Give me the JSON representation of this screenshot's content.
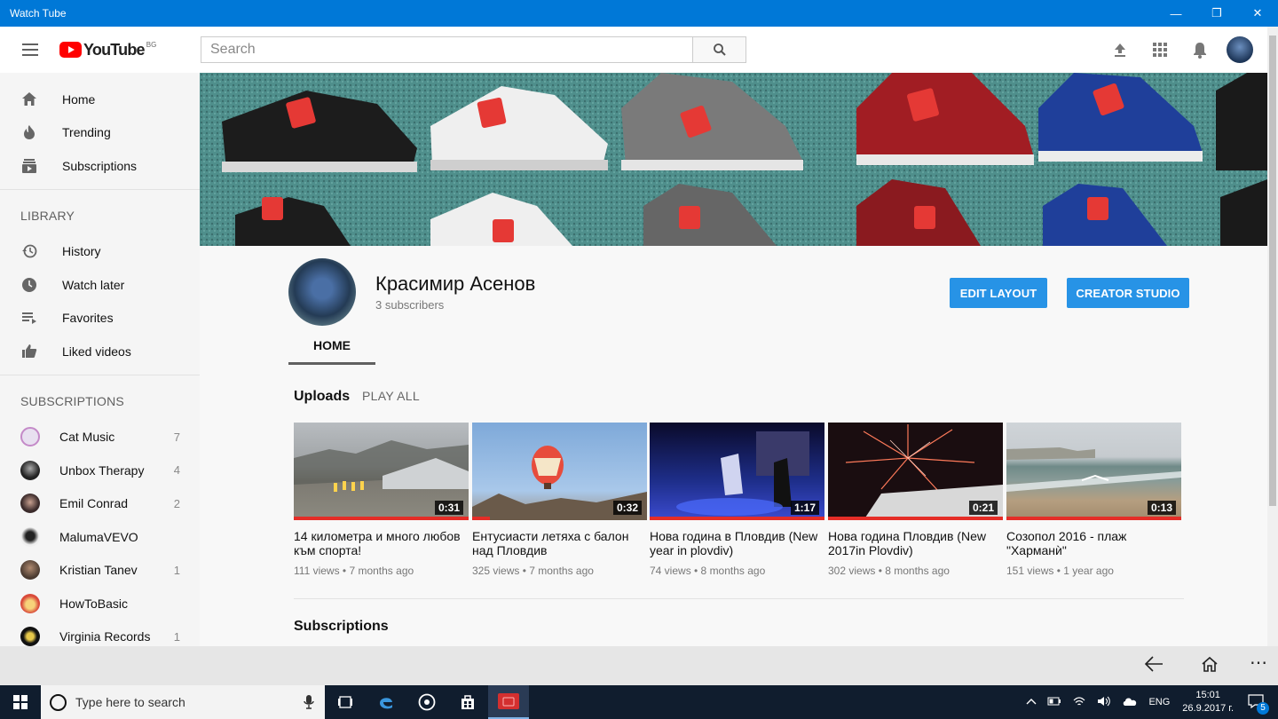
{
  "window": {
    "title": "Watch Tube",
    "minimize": "—",
    "maximize": "❐",
    "close": "✕"
  },
  "masthead": {
    "logo_text": "YouTube",
    "region": "BG",
    "search_placeholder": "Search"
  },
  "sidebar": {
    "main": [
      {
        "label": "Home",
        "icon": "home-icon"
      },
      {
        "label": "Trending",
        "icon": "trending-icon"
      },
      {
        "label": "Subscriptions",
        "icon": "subscriptions-icon"
      }
    ],
    "library_title": "LIBRARY",
    "library": [
      {
        "label": "History",
        "icon": "history-icon"
      },
      {
        "label": "Watch later",
        "icon": "watch-later-icon"
      },
      {
        "label": "Favorites",
        "icon": "playlist-icon"
      },
      {
        "label": "Liked videos",
        "icon": "thumbs-up-icon"
      }
    ],
    "subscriptions_title": "SUBSCRIPTIONS",
    "subscriptions": [
      {
        "label": "Cat Music",
        "count": "7",
        "color": "#e8e0f0"
      },
      {
        "label": "Unbox Therapy",
        "count": "4",
        "color": "#222222"
      },
      {
        "label": "Emil Conrad",
        "count": "2",
        "color": "#3a2a2a"
      },
      {
        "label": "MalumaVEVO",
        "count": "",
        "color": "#f0f0f0"
      },
      {
        "label": "Kristian Tanev",
        "count": "1",
        "color": "#5a4a40"
      },
      {
        "label": "HowToBasic",
        "count": "",
        "color": "#d94a3a"
      },
      {
        "label": "Virginia Records",
        "count": "1",
        "color": "#111111"
      }
    ]
  },
  "channel": {
    "name": "Красимир Асенов",
    "subscribers": "3 subscribers",
    "edit_layout": "EDIT LAYOUT",
    "creator_studio": "CREATOR STUDIO",
    "tab_home": "HOME"
  },
  "uploads": {
    "title": "Uploads",
    "play_all": "PLAY ALL",
    "videos": [
      {
        "title": "14 километра и много любов към спорта!",
        "meta": "111 views • 7 months ago",
        "duration": "0:31"
      },
      {
        "title": "Ентусиасти летяха с балон над Пловдив",
        "meta": "325 views • 7 months ago",
        "duration": "0:32"
      },
      {
        "title": "Нова година в Пловдив (New year in plovdiv)",
        "meta": "74 views • 8 months ago",
        "duration": "1:17"
      },
      {
        "title": "Нова година Пловдив (New 2017in Plovdiv)",
        "meta": "302 views • 8 months ago",
        "duration": "0:21"
      },
      {
        "title": "Созопол 2016 - плаж \"Харманѝ\"",
        "meta": "151 views • 1 year ago",
        "duration": "0:13"
      }
    ]
  },
  "subscriptions_shelf_title": "Subscriptions",
  "taskbar": {
    "search_placeholder": "Type here to search",
    "language": "ENG",
    "time": "15:01",
    "date": "26.9.2017 г.",
    "notifications": "5"
  },
  "colors": {
    "accent": "#0078d7",
    "button_blue": "#2793e6",
    "youtube_red": "#ff0000",
    "progress_red": "#e52d27"
  }
}
